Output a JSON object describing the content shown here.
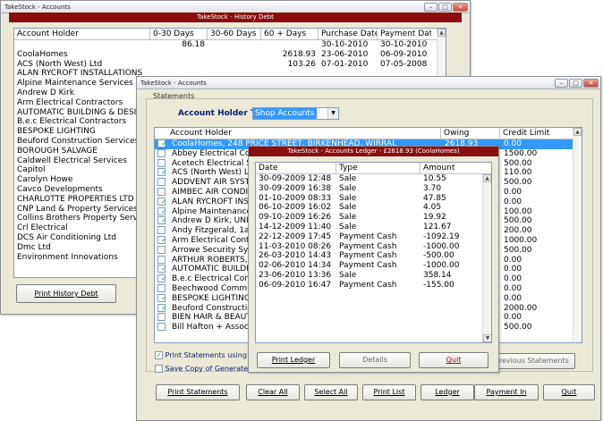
{
  "win1": {
    "title": "TakeStock - Accounts",
    "banner": "TakeStock - History Debt",
    "columns": [
      "Account Holder",
      "0-30 Days",
      "30-60 Days",
      "60 + Days",
      "Purchase Date",
      "Payment Date"
    ],
    "rows": [
      [
        "",
        "86.18",
        "",
        "",
        "30-10-2010",
        "30-10-2010"
      ],
      [
        "CoolaHomes",
        "",
        "",
        "2618.93",
        "23-06-2010",
        "06-09-2010"
      ],
      [
        "ACS (North West) Ltd",
        "",
        "",
        "103.26",
        "07-01-2010",
        "07-05-2008"
      ],
      [
        "ALAN RYCROFT INSTALLATIONS",
        "",
        "",
        "",
        "",
        ""
      ],
      [
        "Alpine Maintenance Services Ltd",
        "",
        "",
        "",
        "",
        ""
      ],
      [
        "Andrew D Kirk",
        "",
        "",
        "",
        "",
        ""
      ],
      [
        "Arm Electrical Contractors",
        "",
        "",
        "",
        "",
        ""
      ],
      [
        "AUTOMATIC BUILDING & DESIGN",
        "",
        "",
        "",
        "",
        ""
      ],
      [
        "B.e.c Electrical Contractors",
        "",
        "",
        "",
        "",
        ""
      ],
      [
        "BESPOKE LIGHTING",
        "",
        "",
        "",
        "",
        ""
      ],
      [
        "Beuford Construction Services LTD",
        "",
        "",
        "",
        "",
        ""
      ],
      [
        "BOROUGH SALVAGE",
        "",
        "",
        "",
        "",
        ""
      ],
      [
        "Caldwell Electrical Services",
        "",
        "",
        "",
        "",
        ""
      ],
      [
        "Capitol",
        "",
        "",
        "",
        "",
        ""
      ],
      [
        "Carolyn Howe",
        "",
        "",
        "",
        "",
        ""
      ],
      [
        "Cavco Developments",
        "",
        "",
        "",
        "",
        ""
      ],
      [
        "CHARLOTTE PROPERTIES LTD",
        "",
        "",
        "",
        "",
        ""
      ],
      [
        "CNP Land & Property Services",
        "",
        "",
        "",
        "",
        ""
      ],
      [
        "Collins Brothers Property Services Ltd",
        "",
        "",
        "",
        "",
        ""
      ],
      [
        "Crl Electrical",
        "",
        "",
        "",
        "",
        ""
      ],
      [
        "DCS Air Conditioning Ltd",
        "",
        "",
        "",
        "",
        ""
      ],
      [
        "Dmc Ltd",
        "",
        "",
        "",
        "",
        ""
      ],
      [
        "Environment Innovations",
        "",
        "",
        "",
        "",
        ""
      ]
    ],
    "print_btn": "Print History Debt"
  },
  "win2": {
    "title": "TakeStock - Accounts",
    "group": "Statements",
    "type_label": "Account Holder Type:",
    "type_value": "Shop Accounts",
    "columns": [
      "Account Holder",
      "Owing",
      "Credit Limit"
    ],
    "rows": [
      {
        "c": true,
        "name": "CoolaHomes, 248 PRICE STREET, BIRKENHEAD, WIRRAL",
        "owing": "2618.93",
        "limit": "0.00",
        "sel": true
      },
      {
        "c": false,
        "name": "Abbey Electrical Contract",
        "owing": "",
        "limit": "1500.00"
      },
      {
        "c": false,
        "name": "Acetech Electrical Servic",
        "owing": "",
        "limit": "500.00"
      },
      {
        "c": true,
        "name": "ACS (North West) Ltd, 25",
        "owing": "",
        "limit": "110.00"
      },
      {
        "c": false,
        "name": "ADDVENT AIR SYSTEM",
        "owing": "",
        "limit": "500.00"
      },
      {
        "c": false,
        "name": "AIMBEC AIR CONDITIO",
        "owing": "",
        "limit": "0.00"
      },
      {
        "c": true,
        "name": "ALAN RYCROFT INSTA",
        "owing": "",
        "limit": "0.00"
      },
      {
        "c": true,
        "name": "Alpine Maintenance Servi",
        "owing": "",
        "limit": "100.00"
      },
      {
        "c": true,
        "name": "Andrew D Kirk, UNIT 1 96",
        "owing": "",
        "limit": "500.00"
      },
      {
        "c": false,
        "name": "Andy Fitzgerald, 1a Ston",
        "owing": "",
        "limit": "200.00"
      },
      {
        "c": true,
        "name": "Arm Electrical Contractor",
        "owing": "",
        "limit": "1000.00"
      },
      {
        "c": false,
        "name": "Arrowe Security Systems",
        "owing": "",
        "limit": "500.00"
      },
      {
        "c": false,
        "name": "ARTHUR ROBERTS, 41",
        "owing": "",
        "limit": "0.00"
      },
      {
        "c": true,
        "name": "AUTOMATIC BUILDING",
        "owing": "",
        "limit": "0.00"
      },
      {
        "c": true,
        "name": "B.e.c Electrical Contracto",
        "owing": "",
        "limit": "0.00"
      },
      {
        "c": false,
        "name": "Beechwood Community T",
        "owing": "",
        "limit": "0.00"
      },
      {
        "c": true,
        "name": "BESPOKE LIGHTING, 1",
        "owing": "",
        "limit": "0.00"
      },
      {
        "c": true,
        "name": "Beuford Construction Ser",
        "owing": "",
        "limit": "2000.00"
      },
      {
        "c": false,
        "name": "BIEN HAIR & BEAUTY,",
        "owing": "",
        "limit": "0.00"
      },
      {
        "c": false,
        "name": "Bill Hafton + Associates,",
        "owing": "",
        "limit": "500.00"
      }
    ],
    "check1": "Print Statements using upfr",
    "check2": "Save Copy of Generated S",
    "prev_btn": "Previous Statements",
    "buttons": [
      "Print Statements",
      "Clear All",
      "Select All",
      "Print List",
      "Ledger",
      "Payment In",
      "Quit"
    ]
  },
  "win3": {
    "title": "TakeStock - Accounts Ledger - £2618.93 (CoolaHomes)",
    "columns": [
      "Date",
      "Type",
      "Amount"
    ],
    "rows": [
      [
        "30-09-2009 12:48",
        "Sale",
        "10.55"
      ],
      [
        "30-09-2009 16:38",
        "Sale",
        "3.70"
      ],
      [
        "01-10-2009 08:33",
        "Sale",
        "47.85"
      ],
      [
        "06-10-2009 16:02",
        "Sale",
        "4.05"
      ],
      [
        "09-10-2009 16:26",
        "Sale",
        "19.92"
      ],
      [
        "14-12-2009 11:40",
        "Sale",
        "121.67"
      ],
      [
        "22-12-2009 17:45",
        "Payment Cash",
        "-1092.19"
      ],
      [
        "11-03-2010 08:26",
        "Payment Cash",
        "-1000.00"
      ],
      [
        "26-03-2010 14:43",
        "Payment Cash",
        "-500.00"
      ],
      [
        "02-06-2010 14:34",
        "Payment Cash",
        "-1000.00"
      ],
      [
        "23-06-2010 13:36",
        "Sale",
        "358.14"
      ],
      [
        "06-09-2010 16:47",
        "Payment Cash",
        "-155.00"
      ]
    ],
    "buttons": [
      "Print Ledger",
      "Details",
      "Quit"
    ]
  }
}
